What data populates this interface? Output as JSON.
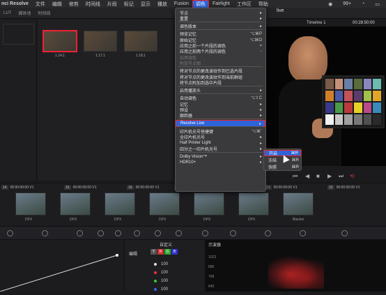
{
  "menubar": {
    "app": "nci Resolve",
    "items": [
      "文件",
      "编辑",
      "修剪",
      "时间线",
      "片段",
      "标记",
      "显示",
      "播放",
      "Fusion"
    ],
    "active": "调色",
    "after": [
      "Fairlight",
      "工作区",
      "帮助"
    ],
    "tray": "99+"
  },
  "toolbar": {
    "lut": "LUT",
    "media": "媒体池",
    "tl": "时间线"
  },
  "viewer": {
    "title": "live",
    "timeline": "Timeline 1",
    "timecode": "00:28:50:00"
  },
  "stills": [
    {
      "label": "1.14.1"
    },
    {
      "label": "1.17.1"
    },
    {
      "label": "1.18.1"
    }
  ],
  "color_menu": {
    "items": [
      {
        "label": "节点",
        "key": "▸",
        "sub": true
      },
      {
        "label": "重置",
        "key": "▸",
        "sub": true
      },
      {
        "sep": true
      },
      {
        "label": "调色版本",
        "key": "▸",
        "sub": true
      },
      {
        "sep": true
      },
      {
        "label": "预览记忆",
        "key": "⌥⌘P"
      },
      {
        "label": "原始记忆",
        "key": "⌥⌘O"
      },
      {
        "label": "应用之前一个片段的调色",
        "key": "="
      },
      {
        "label": "应用之前两个片段的调色",
        "key": "-"
      },
      {
        "label": "启用调色",
        "dis": true
      },
      {
        "label": "附加节点图",
        "dis": true
      },
      {
        "sep": true
      },
      {
        "label": "将对节点的更改波纹作到已选片段"
      },
      {
        "label": "将对节点的更改波纹作到当前群组"
      },
      {
        "label": "将节点附加到选中片段"
      },
      {
        "sep": true
      },
      {
        "label": "启用播放头",
        "key": "▸",
        "sub": true
      },
      {
        "sep": true
      },
      {
        "label": "自动调色",
        "key": "⌥⇧C"
      },
      {
        "label": "记忆",
        "key": "▸",
        "sub": true
      },
      {
        "label": "预设",
        "key": "▸",
        "sub": true
      },
      {
        "label": "跟踪器",
        "key": "▸",
        "sub": true
      },
      {
        "sep": true
      },
      {
        "label": "Resolve Live",
        "key": "▸",
        "hl": true
      },
      {
        "sep": true
      },
      {
        "label": "印片机光号快捷键",
        "key": "⌥⌘`"
      },
      {
        "label": "全印片机光号",
        "key": "▸",
        "sub": true
      },
      {
        "label": "Half Printer Light",
        "key": "▸",
        "sub": true
      },
      {
        "label": "四分之一印片机光号",
        "key": "▸",
        "sub": true
      },
      {
        "sep": true
      },
      {
        "label": "Dolby Vision™",
        "key": "▸",
        "sub": true
      },
      {
        "label": "HDR10+",
        "key": "▸",
        "sub": true
      }
    ]
  },
  "live_submenu": [
    {
      "label": "开启",
      "key": "⌘R",
      "hl": true
    },
    {
      "label": "冻结",
      "key": "⌘R"
    },
    {
      "label": "快照",
      "key": "⌘R"
    }
  ],
  "clips": [
    {
      "num": "V1",
      "tc": "00:00:00:00",
      "n": "14"
    },
    {
      "num": "V1",
      "tc": "00:00:00:00",
      "n": "15"
    },
    {
      "num": "V1",
      "tc": "00:00:00:00",
      "n": "16"
    },
    {
      "num": "V1",
      "tc": "00:00:00:00",
      "n": "17"
    },
    {
      "num": "V1",
      "tc": "00:00:00:00",
      "n": "21"
    },
    {
      "num": "V1",
      "tc": "00:00:00:00",
      "n": "22"
    }
  ],
  "dpx": [
    "DPX",
    "DPX",
    "DPX",
    "DPX",
    "DPX",
    "DPX",
    "Blackm"
  ],
  "color_panel": {
    "edit": "编辑",
    "mode": "自定义",
    "values": [
      "100",
      "100",
      "100",
      "100"
    ]
  },
  "scope": {
    "title": "示波器",
    "ticks": [
      "1023",
      "896",
      "768",
      "640"
    ]
  },
  "chart_colors": [
    "#7a5a48",
    "#c4907a",
    "#6a7fa6",
    "#5a6b3c",
    "#8a87c0",
    "#6bbcae",
    "#d0802a",
    "#4a5aa8",
    "#c4525a",
    "#5a3c6a",
    "#a2c04a",
    "#e0a62a",
    "#3a3a8a",
    "#4a9a4a",
    "#b83a3a",
    "#e8d02a",
    "#b84a8a",
    "#3a8ab8",
    "#f2f2f2",
    "#c8c8c8",
    "#a0a0a0",
    "#787878",
    "#505050",
    "#2a2a2a"
  ]
}
